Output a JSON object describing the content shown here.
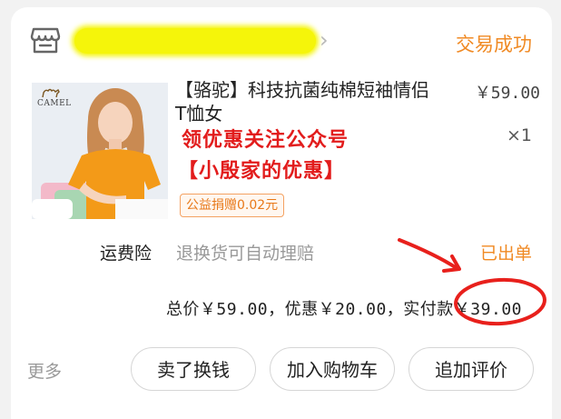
{
  "shop": {
    "icon": "shop-icon",
    "name": "",
    "status": "交易成功"
  },
  "item": {
    "image": {
      "logo_text": "CAMEL"
    },
    "title": "【骆驼】科技抗菌纯棉短袖情侣T恤女",
    "unit_price": "￥59.00",
    "quantity": "×1",
    "promo_lines": [
      "领优惠关注公众号",
      "【小殷家的优惠】"
    ],
    "charity_badge": "公益捐赠0.02元"
  },
  "insurance": {
    "label": "运费险",
    "description": "退换货可自动理赔",
    "status": "已出单"
  },
  "summary": {
    "text": "总价￥59.00，优惠￥20.00，实付款￥39.00"
  },
  "actions": {
    "more": "更多",
    "sell": "卖了换钱",
    "add_to_cart": "加入购物车",
    "add_review": "追加评价"
  },
  "colors": {
    "accent": "#f08a24",
    "promo_red": "#e21c1c",
    "annotation_red": "#e8201c",
    "redaction_yellow": "#f5f50a"
  }
}
